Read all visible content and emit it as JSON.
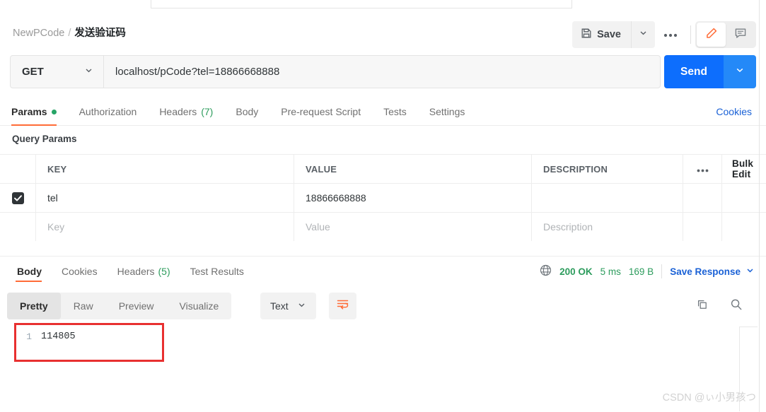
{
  "breadcrumb": {
    "collection": "NewPCode",
    "separator": "/",
    "request": "发送验证码"
  },
  "header": {
    "save_label": "Save",
    "save_icon": "floppy-disk-icon",
    "save_caret_icon": "chevron-down-icon",
    "more_icon": "ellipsis-icon",
    "edit_icon": "pencil-icon",
    "comment_icon": "comment-icon",
    "accent_orange": "#ff6c37"
  },
  "urlbar": {
    "method": "GET",
    "method_caret_icon": "chevron-down-icon",
    "url": "localhost/pCode?tel=18866668888",
    "send_label": "Send",
    "send_caret_icon": "chevron-down-icon",
    "send_color": "#0d6efd"
  },
  "request_tabs": {
    "items": [
      {
        "label": "Params",
        "active": true,
        "dot": true
      },
      {
        "label": "Authorization",
        "active": false
      },
      {
        "label": "Headers",
        "count": "(7)",
        "active": false
      },
      {
        "label": "Body",
        "active": false
      },
      {
        "label": "Pre-request Script",
        "active": false
      },
      {
        "label": "Tests",
        "active": false
      },
      {
        "label": "Settings",
        "active": false
      }
    ],
    "cookies_link": "Cookies"
  },
  "query_params": {
    "section_title": "Query Params",
    "columns": [
      "KEY",
      "VALUE",
      "DESCRIPTION"
    ],
    "more_icon": "ellipsis-icon",
    "bulk_edit_label": "Bulk Edit",
    "rows": [
      {
        "checked": true,
        "key": "tel",
        "value": "18866668888",
        "description": ""
      }
    ],
    "placeholders": {
      "key": "Key",
      "value": "Value",
      "description": "Description"
    }
  },
  "response": {
    "tabs": [
      {
        "label": "Body",
        "active": true
      },
      {
        "label": "Cookies",
        "active": false
      },
      {
        "label": "Headers",
        "count": "(5)",
        "active": false
      },
      {
        "label": "Test Results",
        "active": false
      }
    ],
    "globe_icon": "globe-icon",
    "status": "200 OK",
    "time": "5 ms",
    "size": "169 B",
    "save_response_label": "Save Response",
    "save_response_caret_icon": "chevron-down-icon",
    "status_color": "#2d9c5d",
    "view_modes": [
      {
        "label": "Pretty",
        "active": true
      },
      {
        "label": "Raw",
        "active": false
      },
      {
        "label": "Preview",
        "active": false
      },
      {
        "label": "Visualize",
        "active": false
      }
    ],
    "format": "Text",
    "format_caret_icon": "chevron-down-icon",
    "wrap_icon": "word-wrap-icon",
    "copy_icon": "copy-icon",
    "search_icon": "search-icon",
    "body_lines": [
      {
        "number": "1",
        "text": "114805"
      }
    ],
    "highlight_color": "#e83030"
  },
  "watermark": "CSDN @ぃ小男孩つ"
}
